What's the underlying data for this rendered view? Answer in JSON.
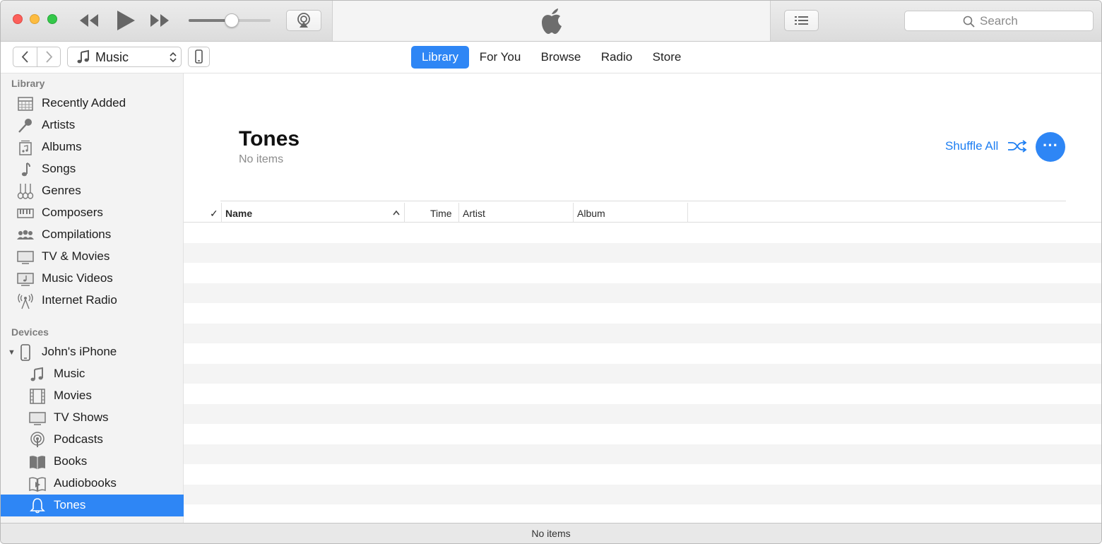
{
  "toolbar": {
    "volume_level": 0.52,
    "search_placeholder": "Search"
  },
  "navbar": {
    "media_kind": "Music",
    "tabs": [
      {
        "label": "Library",
        "active": true
      },
      {
        "label": "For You",
        "active": false
      },
      {
        "label": "Browse",
        "active": false
      },
      {
        "label": "Radio",
        "active": false
      },
      {
        "label": "Store",
        "active": false
      }
    ]
  },
  "sidebar": {
    "library_heading": "Library",
    "library_items": [
      {
        "label": "Recently Added",
        "icon": "recently-added-icon"
      },
      {
        "label": "Artists",
        "icon": "microphone-icon"
      },
      {
        "label": "Albums",
        "icon": "album-icon"
      },
      {
        "label": "Songs",
        "icon": "music-note-icon"
      },
      {
        "label": "Genres",
        "icon": "guitar-icon"
      },
      {
        "label": "Composers",
        "icon": "piano-icon"
      },
      {
        "label": "Compilations",
        "icon": "people-icon"
      },
      {
        "label": "TV & Movies",
        "icon": "tv-icon"
      },
      {
        "label": "Music Videos",
        "icon": "music-video-icon"
      },
      {
        "label": "Internet Radio",
        "icon": "radio-tower-icon"
      }
    ],
    "devices_heading": "Devices",
    "device_name": "John's iPhone",
    "device_items": [
      {
        "label": "Music",
        "icon": "music-note-icon"
      },
      {
        "label": "Movies",
        "icon": "film-icon"
      },
      {
        "label": "TV Shows",
        "icon": "tv-icon"
      },
      {
        "label": "Podcasts",
        "icon": "podcast-icon"
      },
      {
        "label": "Books",
        "icon": "book-icon"
      },
      {
        "label": "Audiobooks",
        "icon": "audiobook-icon"
      },
      {
        "label": "Tones",
        "icon": "bell-icon",
        "selected": true
      }
    ]
  },
  "main": {
    "title": "Tones",
    "subtitle": "No items",
    "shuffle_label": "Shuffle All",
    "more_label": "···",
    "columns": {
      "check": "✓",
      "name": "Name",
      "time": "Time",
      "artist": "Artist",
      "album": "Album"
    }
  },
  "status": {
    "text": "No items"
  },
  "colors": {
    "accent": "#2e86f5",
    "link": "#1d7ef2"
  }
}
